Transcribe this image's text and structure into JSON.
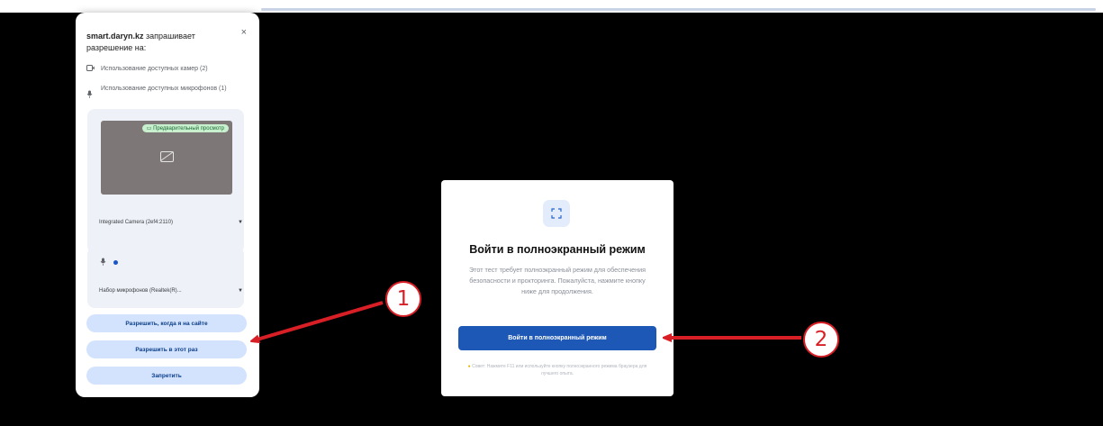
{
  "permission_dialog": {
    "site": "smart.daryn.kz",
    "title_rest": "запрашивает разрешение на:",
    "close_glyph": "×",
    "camera_permission": "Использование доступных камер (2)",
    "mic_permission": "Использование доступных микрофонов (1)",
    "preview_badge": "Предварительный просмотр",
    "camera_select": "Integrated Camera (2ef4:2110)",
    "mic_select": "Набор микрофонов (Realtek(R)...",
    "buttons": {
      "allow_on_site": "Разрешить, когда я на сайте",
      "allow_once": "Разрешить в этот раз",
      "deny": "Запретить"
    }
  },
  "fullscreen_card": {
    "title": "Войти в полноэкранный режим",
    "description": "Этот тест требует полноэкранный режим для обеспечения безопасности и прокторинга. Пожалуйста, нажмите кнопку ниже для продолжения.",
    "button": "Войти в полноэкранный режим",
    "hint": "Совет: Нажмите F11 или используйте кнопку полноэкранного режима браузера для лучшего опыта."
  },
  "annotations": {
    "marker_1": "1",
    "marker_2": "2",
    "color": "#d91f26"
  },
  "colors": {
    "screen_bg": "#000000",
    "primary_blue": "#1e58b6",
    "permission_button_bg": "#d3e3fd"
  }
}
